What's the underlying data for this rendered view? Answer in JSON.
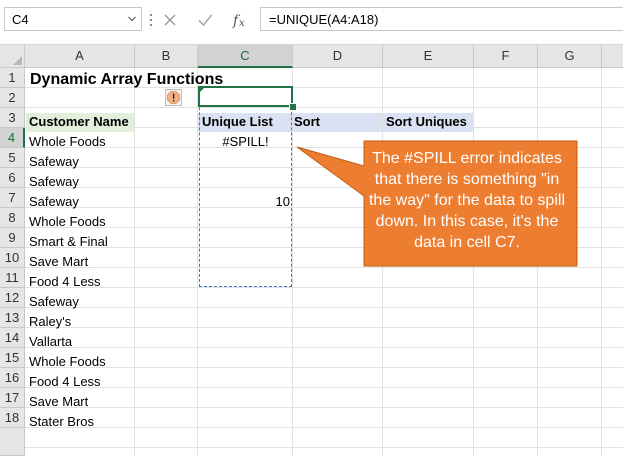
{
  "formula_bar": {
    "name_box": "C4",
    "formula": "=UNIQUE(A4:A18)",
    "icons": [
      "chevron-down-icon",
      "cancel-icon",
      "confirm-icon",
      "function-icon"
    ]
  },
  "columns": [
    "A",
    "B",
    "C",
    "D",
    "E",
    "F",
    "G"
  ],
  "selected_column": "C",
  "rows": [
    "1",
    "2",
    "3",
    "4",
    "5",
    "6",
    "7",
    "8",
    "9",
    "10",
    "11",
    "12",
    "13",
    "14",
    "15",
    "16",
    "17",
    "18"
  ],
  "selected_row": "4",
  "sheet": {
    "title": "Dynamic Array Functions",
    "headers": {
      "customer_name": "Customer Name",
      "unique_list": "Unique List",
      "sort": "Sort",
      "sort_uniques": "Sort Uniques"
    },
    "customers": [
      "Whole Foods",
      "Safeway",
      "Safeway",
      "Safeway",
      "Whole Foods",
      "Smart & Final",
      "Save Mart",
      "Food 4 Less",
      "Safeway",
      "Raley's",
      "Vallarta",
      "Whole Foods",
      "Food 4 Less",
      "Save Mart",
      "Stater Bros"
    ],
    "c4_value": "#SPILL!",
    "c7_value": "10"
  },
  "error_button": {
    "icon": "warning-icon"
  },
  "callout": {
    "text": "The #SPILL error indicates that there is something \"in the way\" for the data to spill down. In this case, it's the data in cell C7.",
    "color": "#ed7d31"
  },
  "colors": {
    "header_green_fill": "#e2efda",
    "header_blue_fill": "#d9e1f2",
    "excel_green": "#217346"
  }
}
